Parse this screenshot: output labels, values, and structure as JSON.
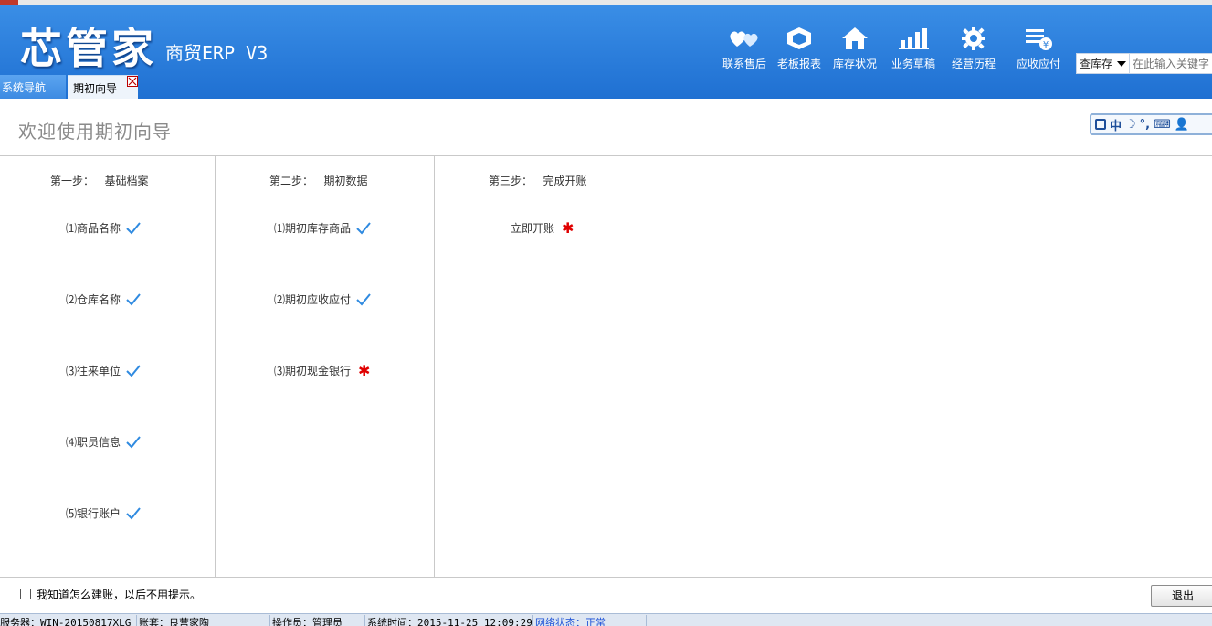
{
  "app": {
    "logo": "芯管家",
    "subtitle": "商贸ERP V3"
  },
  "nav": [
    {
      "label": "联系售后",
      "icon": "hearts-icon"
    },
    {
      "label": "老板报表",
      "icon": "cube-icon"
    },
    {
      "label": "库存状况",
      "icon": "house-icon"
    },
    {
      "label": "业务草稿",
      "icon": "bars-icon"
    },
    {
      "label": "经营历程",
      "icon": "gear-icon"
    },
    {
      "label": "应收应付",
      "icon": "ledger-icon"
    }
  ],
  "search": {
    "select_value": "查库存",
    "placeholder": "在此输入关键字"
  },
  "tabs": {
    "nav_label": "系统导航",
    "wizard_label": "期初向导"
  },
  "page": {
    "title": "欢迎使用期初向导"
  },
  "ime": {
    "lang": "中"
  },
  "steps": [
    {
      "title": "第一步：   基础档案",
      "items": [
        {
          "label": "⑴商品名称",
          "status": "done"
        },
        {
          "label": "⑵仓库名称",
          "status": "done"
        },
        {
          "label": "⑶往来单位",
          "status": "done"
        },
        {
          "label": "⑷职员信息",
          "status": "done"
        },
        {
          "label": "⑸银行账户",
          "status": "done"
        }
      ]
    },
    {
      "title": "第二步：   期初数据",
      "items": [
        {
          "label": "⑴期初库存商品",
          "status": "done"
        },
        {
          "label": "⑵期初应收应付",
          "status": "done"
        },
        {
          "label": "⑶期初现金银行",
          "status": "required"
        }
      ]
    },
    {
      "title": "第三步：   完成开账",
      "items": [
        {
          "label": "立即开账",
          "status": "required"
        }
      ]
    }
  ],
  "footer": {
    "checkbox_label": "我知道怎么建账，以后不用提示。",
    "exit_label": "退出"
  },
  "status": {
    "server": "服务器：WIN-20150817XLG",
    "account": "账套：良营家陶",
    "operator": "操作员：管理员",
    "time": "系统时间：2015-11-25 12:09:29",
    "network": "网络状态：正常"
  },
  "colors": {
    "header": "#2a7fdb",
    "check": "#2f8ae0",
    "required": "#e00000"
  }
}
